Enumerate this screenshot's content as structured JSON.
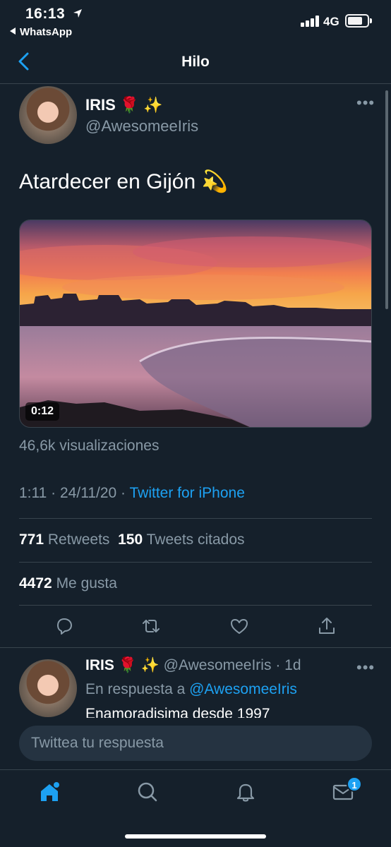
{
  "status_bar": {
    "time": "16:13",
    "back_app": "WhatsApp",
    "network": "4G"
  },
  "nav": {
    "title": "Hilo"
  },
  "tweet": {
    "display_name": "IRIS 🌹 ✨",
    "handle": "@AwesomeeIris",
    "text": "Atardecer en Gijón 💫",
    "video_duration": "0:12",
    "views": "46,6k visualizaciones",
    "time": "1:11",
    "date": "24/11/20",
    "source": "Twitter for iPhone",
    "retweets_count": "771",
    "retweets_label": "Retweets",
    "quotes_count": "150",
    "quotes_label": "Tweets citados",
    "likes_count": "4472",
    "likes_label": "Me gusta"
  },
  "reply": {
    "display_name": "IRIS 🌹 ✨",
    "handle": "@AwesomeeIris",
    "age": "1d",
    "reply_prefix": "En respuesta a",
    "reply_to": "@AwesomeeIris",
    "text_partial": "Enamoradisima desde 1997"
  },
  "compose": {
    "placeholder": "Twittea tu respuesta"
  },
  "tabbar": {
    "messages_badge": "1"
  },
  "colors": {
    "background": "#15202b",
    "accent": "#1da1f2",
    "secondary_text": "#8899a6",
    "divider": "#38444d"
  },
  "icons": [
    "location-arrow-icon",
    "back-chevron-icon",
    "more-icon",
    "reply-icon",
    "retweet-icon",
    "like-icon",
    "share-icon",
    "home-icon",
    "search-icon",
    "notifications-icon",
    "messages-icon"
  ]
}
